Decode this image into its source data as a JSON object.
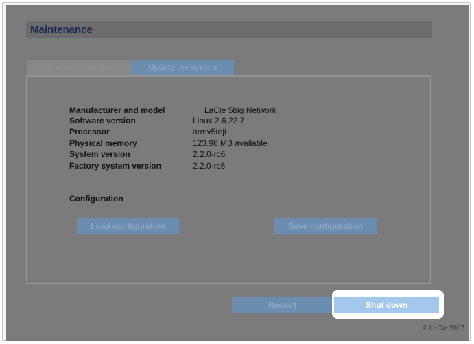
{
  "header": {
    "title": "Maintenance"
  },
  "tabs": [
    {
      "label": "Device information"
    },
    {
      "label": "Update the system"
    }
  ],
  "device_info": [
    {
      "label": "Manufacturer and model",
      "value": "LaCie 5big Network"
    },
    {
      "label": "Software version",
      "value": "Linux 2.6.22.7"
    },
    {
      "label": "Processor",
      "value": "armv5teji"
    },
    {
      "label": "Physical memory",
      "value": "123.96 MB available"
    },
    {
      "label": "System version",
      "value": "2.2.0-rc6"
    },
    {
      "label": "Factory system version",
      "value": "2.2.0-rc6"
    }
  ],
  "configuration": {
    "title": "Configuration",
    "load_label": "Load configuration",
    "save_label": "Save configuration"
  },
  "actions": {
    "restart_label": "Restart",
    "shutdown_label": "Shut down"
  },
  "footer": {
    "copyright": "© LaCie 2007"
  }
}
